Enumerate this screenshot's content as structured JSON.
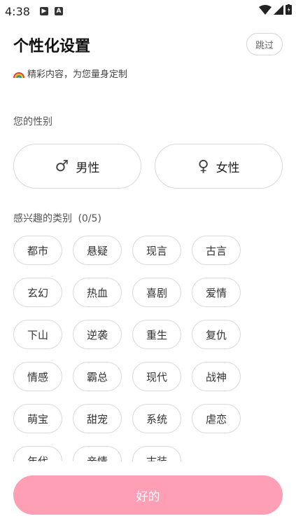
{
  "status_bar": {
    "time": "4:38"
  },
  "header": {
    "title": "个性化设置",
    "skip_label": "跳过",
    "subtitle": "精彩内容，为您量身定制"
  },
  "gender": {
    "label": "您的性别",
    "male": {
      "symbol": "♂",
      "label": "男性"
    },
    "female": {
      "symbol": "♀",
      "label": "女性"
    }
  },
  "interests": {
    "label": "感兴趣的类别",
    "count": "(0/5)",
    "items": [
      "都市",
      "悬疑",
      "现言",
      "古言",
      "玄幻",
      "热血",
      "喜剧",
      "爱情",
      "下山",
      "逆袭",
      "重生",
      "复仇",
      "情感",
      "霸总",
      "现代",
      "战神",
      "萌宝",
      "甜宠",
      "系统",
      "虐恋",
      "年代",
      "亲情",
      "古装"
    ]
  },
  "confirm_label": "好的",
  "colors": {
    "accent": "#ff9fb6"
  }
}
